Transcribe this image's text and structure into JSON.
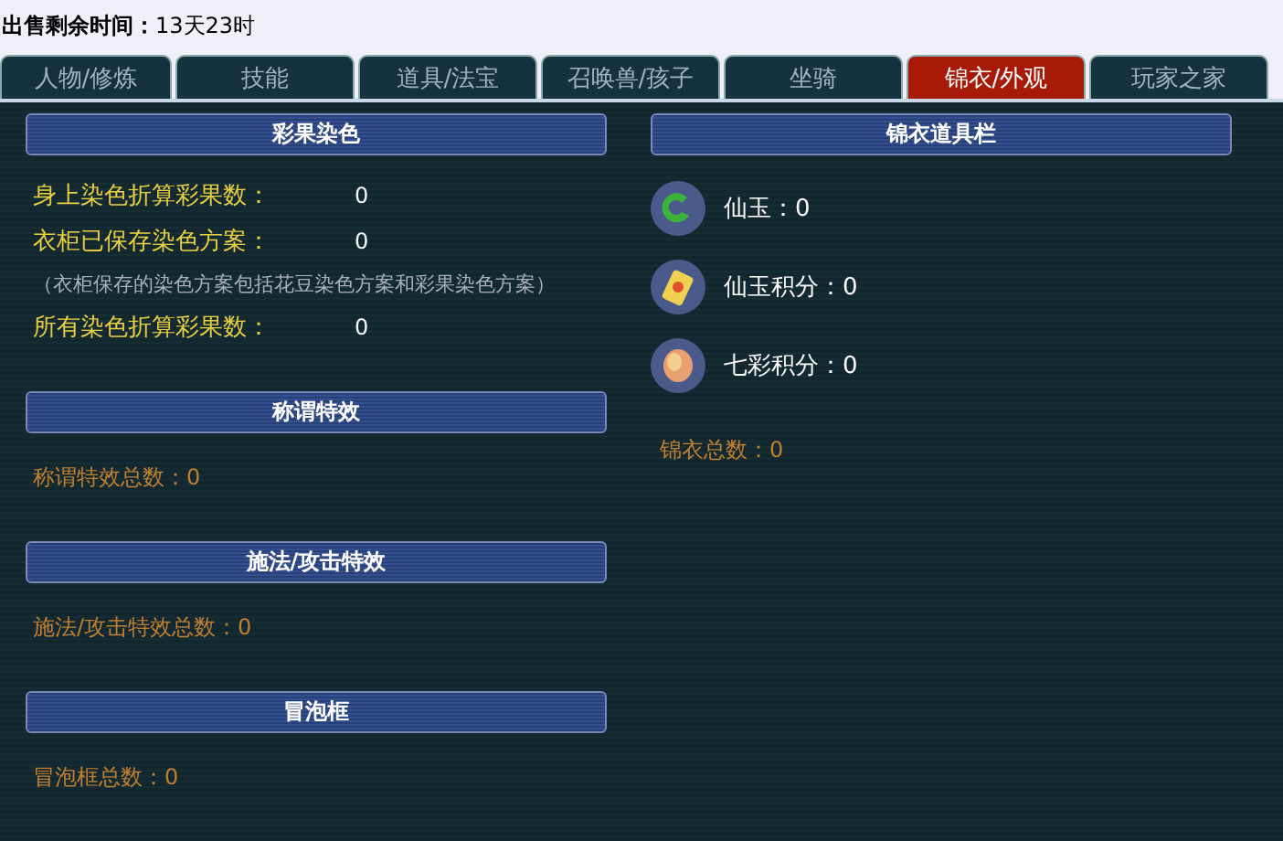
{
  "sale_time": {
    "label": "出售剩余时间：",
    "value": "13天23时"
  },
  "tabs": [
    {
      "label": "人物/修炼",
      "selected": false
    },
    {
      "label": "技能",
      "selected": false
    },
    {
      "label": "道具/法宝",
      "selected": false
    },
    {
      "label": "召唤兽/孩子",
      "selected": false
    },
    {
      "label": "坐骑",
      "selected": false
    },
    {
      "label": "锦衣/外观",
      "selected": true
    },
    {
      "label": "玩家之家",
      "selected": false
    }
  ],
  "left_sections": [
    {
      "title": "彩果染色",
      "rows": [
        {
          "kind": "pair",
          "label": "身上染色折算彩果数：",
          "value": "0"
        },
        {
          "kind": "pair",
          "label": "衣柜已保存染色方案：",
          "value": "0"
        },
        {
          "kind": "note",
          "text": "（衣柜保存的染色方案包括花豆染色方案和彩果染色方案）"
        },
        {
          "kind": "pair",
          "label": "所有染色折算彩果数：",
          "value": "0"
        }
      ]
    },
    {
      "title": "称谓特效",
      "rows": [
        {
          "kind": "total",
          "text": "称谓特效总数：0"
        }
      ]
    },
    {
      "title": "施法/攻击特效",
      "rows": [
        {
          "kind": "total",
          "text": "施法/攻击特效总数：0"
        }
      ]
    },
    {
      "title": "冒泡框",
      "rows": [
        {
          "kind": "total",
          "text": "冒泡框总数：0"
        }
      ]
    }
  ],
  "right_section": {
    "title": "锦衣道具栏",
    "items": [
      {
        "kind": "jade",
        "text": "仙玉：0"
      },
      {
        "kind": "card",
        "text": "仙玉积分：0"
      },
      {
        "kind": "shell",
        "text": "七彩积分：0"
      }
    ],
    "total": "锦衣总数：0"
  }
}
